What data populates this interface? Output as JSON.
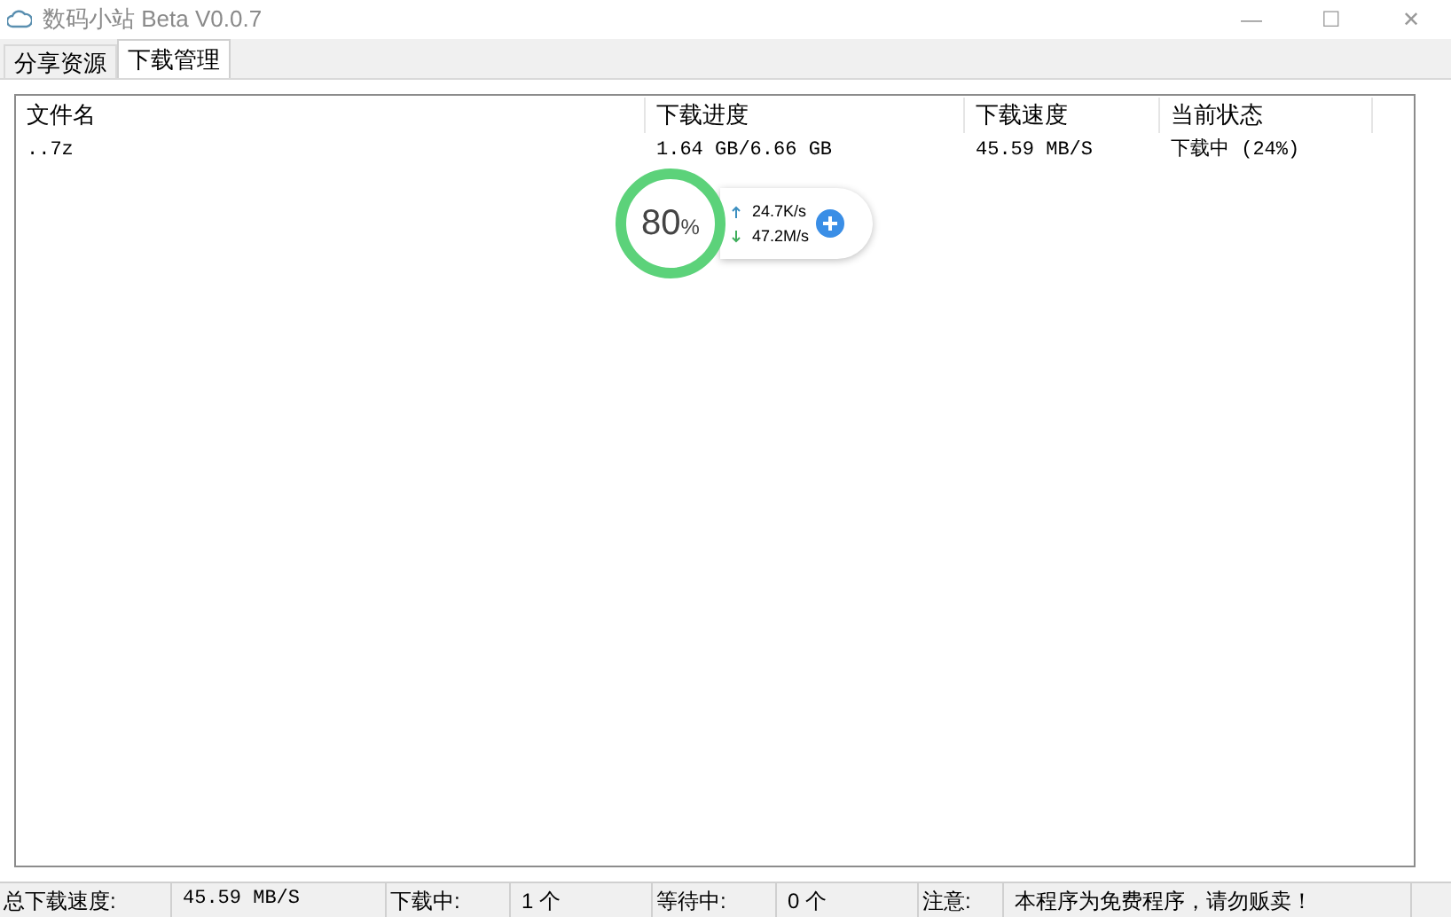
{
  "window": {
    "title": "数码小站 Beta V0.0.7",
    "controls": [
      "—",
      "☐",
      "✕"
    ]
  },
  "tabs": [
    {
      "label": "分享资源",
      "selected": false
    },
    {
      "label": "下载管理",
      "selected": true
    }
  ],
  "table": {
    "columns": [
      "文件名",
      "下载进度",
      "下载速度",
      "当前状态"
    ],
    "rows": [
      [
        "..7z",
        "1.64 GB/6.66 GB",
        "45.59 MB/S",
        "下载中 (24%)"
      ]
    ]
  },
  "speed_widget": {
    "percent": "80",
    "unit": "%",
    "upload": "24.7K/s",
    "download": "47.2M/s"
  },
  "status_bar": [
    {
      "label": "总下载速度:",
      "value": "45.59 MB/S"
    },
    {
      "label": "下载中:",
      "value": "1 个"
    },
    {
      "label": "等待中:",
      "value": "0 个"
    },
    {
      "label": "注意:",
      "value": "本程序为免费程序，请勿贩卖！"
    }
  ]
}
